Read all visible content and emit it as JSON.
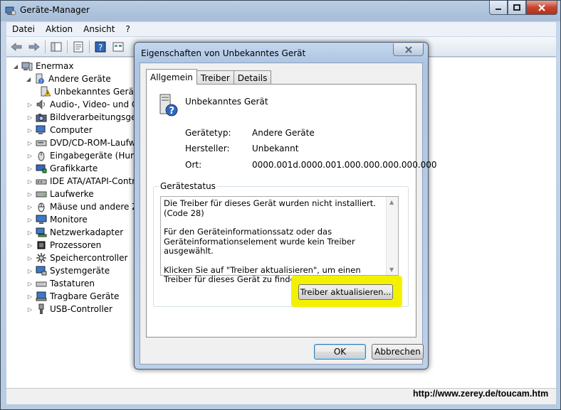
{
  "main_window": {
    "title": "Geräte-Manager",
    "menu": [
      "Datei",
      "Aktion",
      "Ansicht",
      "?"
    ]
  },
  "tree": {
    "root": "Enermax",
    "items": [
      {
        "label": "Andere Geräte",
        "icon": "unknown-device-icon"
      },
      {
        "label": "Unbekanntes Gerät",
        "icon": "warning-device-icon"
      },
      {
        "label": "Audio-, Video- und Ga",
        "icon": "speaker-icon"
      },
      {
        "label": "Bildverarbeitungsgerät",
        "icon": "camera-icon"
      },
      {
        "label": "Computer",
        "icon": "computer-icon"
      },
      {
        "label": "DVD/CD-ROM-Laufwe",
        "icon": "dvd-drive-icon"
      },
      {
        "label": "Eingabegeräte (Human",
        "icon": "input-device-icon"
      },
      {
        "label": "Grafikkarte",
        "icon": "display-adapter-icon"
      },
      {
        "label": "IDE ATA/ATAPI-Contro",
        "icon": "ide-controller-icon"
      },
      {
        "label": "Laufwerke",
        "icon": "disk-drive-icon"
      },
      {
        "label": "Mäuse und andere Zei",
        "icon": "mouse-icon"
      },
      {
        "label": "Monitore",
        "icon": "monitor-icon"
      },
      {
        "label": "Netzwerkadapter",
        "icon": "network-adapter-icon"
      },
      {
        "label": "Prozessoren",
        "icon": "processor-icon"
      },
      {
        "label": "Speichercontroller",
        "icon": "storage-controller-icon"
      },
      {
        "label": "Systemgeräte",
        "icon": "system-device-icon"
      },
      {
        "label": "Tastaturen",
        "icon": "keyboard-icon"
      },
      {
        "label": "Tragbare Geräte",
        "icon": "portable-device-icon"
      },
      {
        "label": "USB-Controller",
        "icon": "usb-icon"
      }
    ]
  },
  "dialog": {
    "title": "Eigenschaften von Unbekanntes Gerät",
    "tabs": [
      "Allgemein",
      "Treiber",
      "Details"
    ],
    "device_name": "Unbekanntes Gerät",
    "properties": {
      "type_label": "Gerätetyp:",
      "type_value": "Andere Geräte",
      "maker_label": "Hersteller:",
      "maker_value": "Unbekannt",
      "location_label": "Ort:",
      "location_value": "0000.001d.0000.001.000.000.000.000.000"
    },
    "status": {
      "legend": "Gerätestatus",
      "line1": "Die Treiber für dieses Gerät wurden nicht installiert. (Code 28)",
      "line2": "Für den Geräteinformationssatz oder das Geräteinformationselement wurde kein Treiber ausgewählt.",
      "line3": "Klicken Sie auf \"Treiber aktualisieren\", um einen Treiber für dieses Gerät zu finden."
    },
    "update_button": "Treiber aktualisieren...",
    "ok_button": "OK",
    "cancel_button": "Abbrechen"
  },
  "overlay_url": "http://www.zerey.de/toucam.htm",
  "colors": {
    "highlight": "#f4f100",
    "title_gradient": "#b9cde3"
  }
}
